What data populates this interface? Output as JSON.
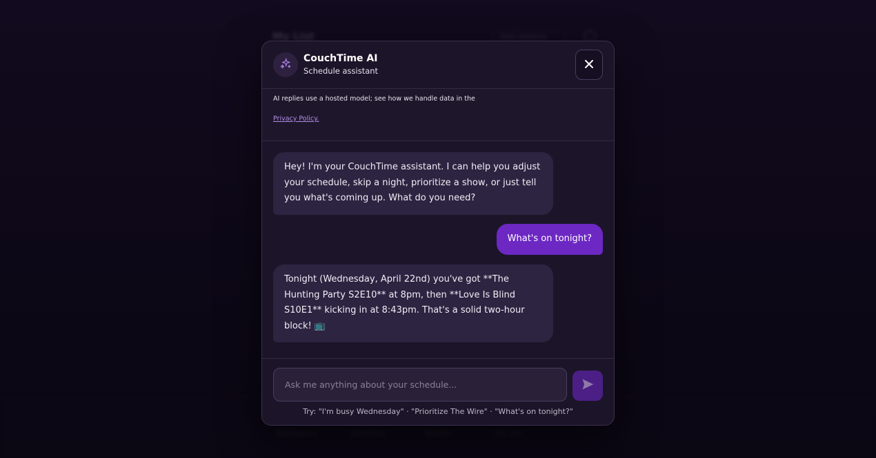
{
  "background": {
    "title": "My List",
    "header_pill": "View Analysis",
    "nav": [
      "Dashboard",
      "Schedule",
      "Search",
      "My List"
    ]
  },
  "modal": {
    "title": "CouchTime AI",
    "subtitle": "Schedule assistant",
    "notice": "AI replies use a hosted model; see how we handle data in the",
    "notice_link": "Privacy Policy.",
    "messages": [
      {
        "role": "assistant",
        "text": "Hey! I'm your CouchTime assistant. I can help you adjust your schedule, skip a night, prioritize a show, or just tell you what's coming up. What do you need?"
      },
      {
        "role": "user",
        "text": "What's on tonight?"
      },
      {
        "role": "assistant",
        "text": "Tonight (Wednesday, April 22nd) you've got **The Hunting Party S2E10** at 8pm, then **Love Is Blind S10E1** kicking in at 8:43pm. That's a solid two-hour block! 📺"
      }
    ],
    "input_placeholder": "Ask me anything about your schedule...",
    "input_value": "",
    "suggestions": "Try: \"I'm busy Wednesday\" · \"Prioritize The Wire\" · \"What's on tonight?\""
  },
  "icons": {
    "avatar": "sparkles-icon",
    "close": "close-icon",
    "send": "send-icon"
  },
  "colors": {
    "accent": "#6d28c4",
    "send_button": "#4b1f86",
    "link": "#b38ce6",
    "modal_bg": "#1c1529",
    "assistant_bubble": "#2d2441"
  }
}
